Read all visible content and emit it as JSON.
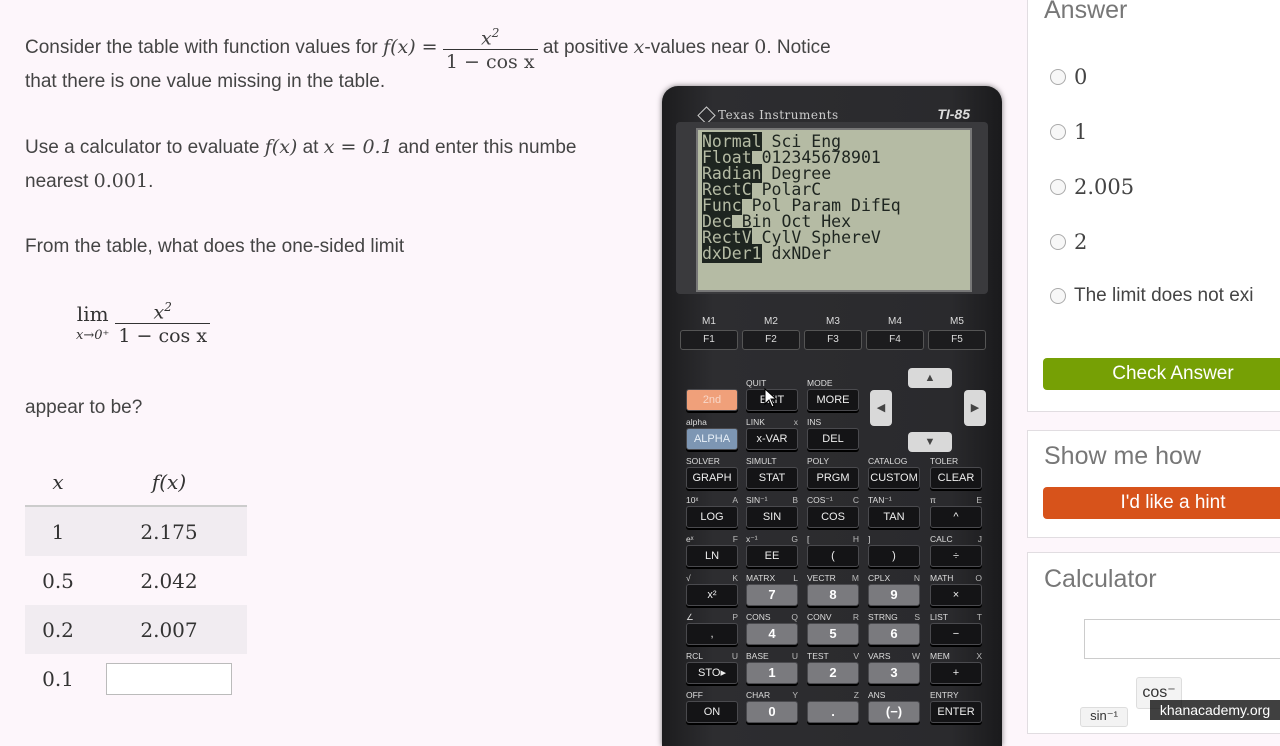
{
  "question": {
    "p1_pre": "Consider the table with function values for",
    "f_lhs": "f(x) =",
    "frac_num": "x",
    "frac_num_exp": "2",
    "frac_den": "1 − cos x",
    "p1_mid": "at positive",
    "p1_var": "x",
    "p1_mid2": "-values near",
    "p1_zero": "0",
    "p1_post": ". Notice",
    "p1_line2": "that there is one value missing in the table.",
    "p2_pre": "Use a calculator to evaluate",
    "p2_fx": "f(x)",
    "p2_at": "at",
    "p2_eq": "x = 0.1",
    "p2_post": "and enter this numbe",
    "p2_line2_pre": "nearest",
    "p2_line2_num": "0.001",
    "p2_line2_post": ".",
    "p3": "From the table, what does the one-sided limit",
    "limit_word": "lim",
    "limit_sub": "x→0⁺",
    "p4": "appear to be?"
  },
  "table": {
    "headers": [
      "x",
      "f(x)"
    ],
    "rows": [
      {
        "x": "1",
        "fx": "2.175"
      },
      {
        "x": "0.5",
        "fx": "2.042"
      },
      {
        "x": "0.2",
        "fx": "2.007"
      },
      {
        "x": "0.1",
        "fx": ""
      }
    ]
  },
  "calculator": {
    "brand": "Texas Instruments",
    "model": "TI-85",
    "screen": [
      {
        "hl": "Normal",
        "rest": " Sci Eng"
      },
      {
        "hl": "Float",
        "rest": " 012345678901"
      },
      {
        "hl": "Radian",
        "rest": " Degree"
      },
      {
        "hl": "RectC",
        "rest": " PolarC"
      },
      {
        "hl": "Func",
        "rest": " Pol Param DifEq"
      },
      {
        "hl": "Dec",
        "rest": " Bin Oct Hex"
      },
      {
        "hl": "RectV",
        "rest": " CylV SphereV"
      },
      {
        "hl": "dxDer1",
        "rest": " dxNDer"
      }
    ],
    "fkeys": [
      {
        "label": "M1",
        "key": "F1"
      },
      {
        "label": "M2",
        "key": "F2"
      },
      {
        "label": "M3",
        "key": "F3"
      },
      {
        "label": "M4",
        "key": "F4"
      },
      {
        "label": "M5",
        "key": "F5"
      }
    ],
    "keys": {
      "k2nd": {
        "top": "",
        "alt": "",
        "label": "2nd"
      },
      "exit": {
        "top": "QUIT",
        "alt": "",
        "label": "EXIT"
      },
      "more": {
        "top": "MODE",
        "alt": "",
        "label": "MORE"
      },
      "alpha": {
        "top": "alpha",
        "alt": "",
        "label": "ALPHA"
      },
      "xvar": {
        "top": "LINK",
        "alt": "x",
        "label": "x-VAR"
      },
      "del": {
        "top": "INS",
        "alt": "",
        "label": "DEL"
      },
      "graph": {
        "top": "SOLVER",
        "alt": "",
        "label": "GRAPH"
      },
      "stat": {
        "top": "SIMULT",
        "alt": "",
        "label": "STAT"
      },
      "prgm": {
        "top": "POLY",
        "alt": "",
        "label": "PRGM"
      },
      "custom": {
        "top": "CATALOG",
        "alt": "",
        "label": "CUSTOM"
      },
      "clear": {
        "top": "TOLER",
        "alt": "",
        "label": "CLEAR"
      },
      "log": {
        "top": "10ˣ",
        "alt": "A",
        "label": "LOG"
      },
      "sin": {
        "top": "SIN⁻¹",
        "alt": "B",
        "label": "SIN"
      },
      "cos": {
        "top": "COS⁻¹",
        "alt": "C",
        "label": "COS"
      },
      "tan": {
        "top": "TAN⁻¹",
        "alt": "",
        "label": "TAN"
      },
      "pow": {
        "top": "π",
        "alt": "E",
        "label": "^"
      },
      "ln": {
        "top": "eˣ",
        "alt": "F",
        "label": "LN"
      },
      "ee": {
        "top": "x⁻¹",
        "alt": "G",
        "label": "EE"
      },
      "lpar": {
        "top": "[",
        "alt": "H",
        "label": "("
      },
      "rpar": {
        "top": "]",
        "alt": "",
        "label": ")"
      },
      "div": {
        "top": "CALC",
        "alt": "J",
        "label": "÷"
      },
      "sq": {
        "top": "√",
        "alt": "K",
        "label": "x²"
      },
      "k7": {
        "top": "MATRX",
        "alt": "L",
        "label": "7"
      },
      "k8": {
        "top": "VECTR",
        "alt": "M",
        "label": "8"
      },
      "k9": {
        "top": "CPLX",
        "alt": "N",
        "label": "9"
      },
      "mul": {
        "top": "MATH",
        "alt": "O",
        "label": "×"
      },
      "comma": {
        "top": "∠",
        "alt": "P",
        "label": ","
      },
      "k4": {
        "top": "CONS",
        "alt": "Q",
        "label": "4"
      },
      "k5": {
        "top": "CONV",
        "alt": "R",
        "label": "5"
      },
      "k6": {
        "top": "STRNG",
        "alt": "S",
        "label": "6"
      },
      "sub": {
        "top": "LIST",
        "alt": "T",
        "label": "−"
      },
      "sto": {
        "top": "RCL",
        "alt": "U",
        "label": "STO▸"
      },
      "k1": {
        "top": "BASE",
        "alt": "U",
        "label": "1"
      },
      "k2": {
        "top": "TEST",
        "alt": "V",
        "label": "2"
      },
      "k3": {
        "top": "VARS",
        "alt": "W",
        "label": "3"
      },
      "add": {
        "top": "MEM",
        "alt": "X",
        "label": "+"
      },
      "on": {
        "top": "OFF",
        "alt": "",
        "label": "ON"
      },
      "k0": {
        "top": "CHAR",
        "alt": "Y",
        "label": "0"
      },
      "dot": {
        "top": "",
        "alt": "Z",
        "label": "."
      },
      "neg": {
        "top": "ANS",
        "alt": "",
        "label": "(−)"
      },
      "enter": {
        "top": "ENTRY",
        "alt": "",
        "label": "ENTER"
      }
    }
  },
  "sidebar": {
    "answer_title": "Answer",
    "options": [
      "0",
      "1",
      "2.005",
      "2",
      "The limit does not exi"
    ],
    "check_button": "Check Answer",
    "show_title": "Show me how",
    "hint_button": "I'd like a hint",
    "calc_title": "Calculator",
    "cos_key": "cos⁻",
    "small_key": "sin⁻¹"
  },
  "watermark": "khanacademy.org",
  "colors": {
    "page_bg": "#fdf6fb",
    "check_green": "#76a005",
    "hint_orange": "#d7531b",
    "lcd": "#b5bba4"
  }
}
